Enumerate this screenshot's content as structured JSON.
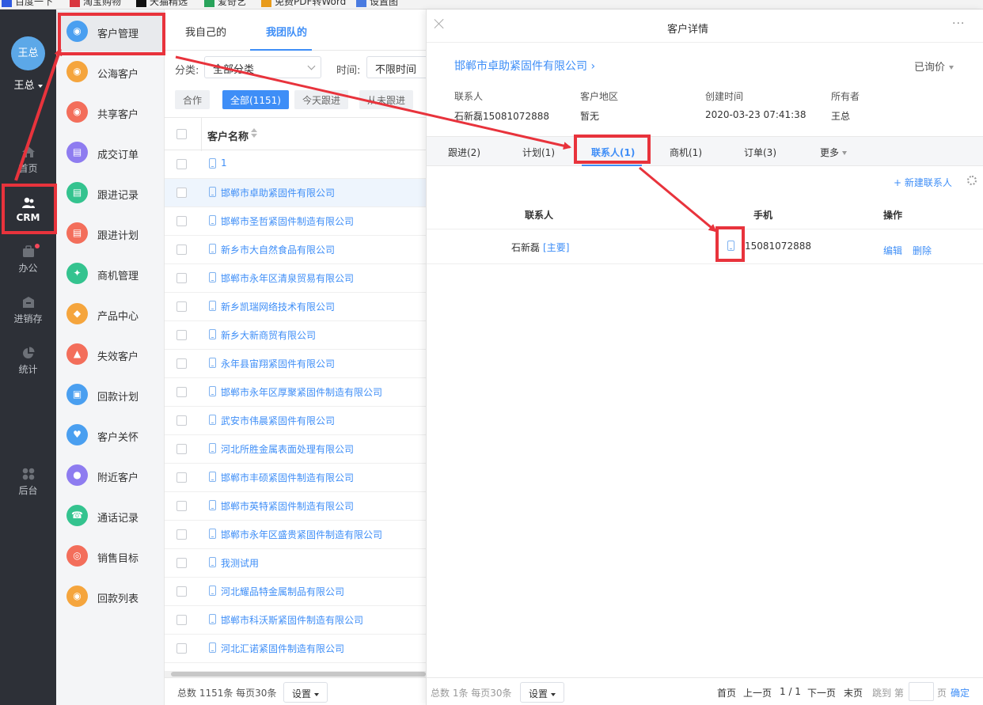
{
  "bookmarks": [
    {
      "label": "百度一下",
      "color": "#2f5ae0"
    },
    {
      "label": "淘宝购物",
      "color": "#d9363e"
    },
    {
      "label": "天猫精选",
      "color": "#111111"
    },
    {
      "label": "爱奇艺",
      "color": "#29a35b"
    },
    {
      "label": "免费PDF转Word",
      "color": "#e89b1c"
    },
    {
      "label": "设置图",
      "color": "#4a7be0"
    }
  ],
  "sidebar": {
    "avatar_text": "王总",
    "user_name": "王总",
    "items": [
      {
        "label": "首页",
        "icon": "home-icon"
      },
      {
        "label": "CRM",
        "icon": "crm-icon"
      },
      {
        "label": "办公",
        "icon": "office-icon"
      },
      {
        "label": "进销存",
        "icon": "inventory-icon"
      },
      {
        "label": "统计",
        "icon": "chart-pie-icon"
      },
      {
        "label": "后台",
        "icon": "grid-icon"
      }
    ]
  },
  "menu": {
    "items": [
      {
        "label": "客户管理",
        "color": "#4a9ff0",
        "icon": "customer-icon"
      },
      {
        "label": "公海客户",
        "color": "#f5a53d",
        "icon": "public-customer-icon"
      },
      {
        "label": "共享客户",
        "color": "#f36e5b",
        "icon": "share-customer-icon"
      },
      {
        "label": "成交订单",
        "color": "#8e7cf0",
        "icon": "order-icon"
      },
      {
        "label": "跟进记录",
        "color": "#34c38f",
        "icon": "record-icon"
      },
      {
        "label": "跟进计划",
        "color": "#f36e5b",
        "icon": "plan-icon"
      },
      {
        "label": "商机管理",
        "color": "#34c38f",
        "icon": "opportunity-icon"
      },
      {
        "label": "产品中心",
        "color": "#f5a53d",
        "icon": "product-icon"
      },
      {
        "label": "失效客户",
        "color": "#f36e5b",
        "icon": "invalid-customer-icon"
      },
      {
        "label": "回款计划",
        "color": "#4a9ff0",
        "icon": "payment-plan-icon"
      },
      {
        "label": "客户关怀",
        "color": "#4a9ff0",
        "icon": "care-icon"
      },
      {
        "label": "附近客户",
        "color": "#8e7cf0",
        "icon": "nearby-icon"
      },
      {
        "label": "通话记录",
        "color": "#34c38f",
        "icon": "call-icon"
      },
      {
        "label": "销售目标",
        "color": "#f36e5b",
        "icon": "target-icon"
      },
      {
        "label": "回款列表",
        "color": "#f5a53d",
        "icon": "payment-list-icon"
      }
    ]
  },
  "list": {
    "tabs": [
      "我自己的",
      "我团队的"
    ],
    "filter_category_label": "分类:",
    "filter_category_value": "全部分类",
    "filter_time_label": "时间:",
    "filter_time_value": "不限时间",
    "chips": [
      "合作",
      "全部(1151)",
      "今天跟进",
      "从未跟进"
    ],
    "column_header": "客户名称",
    "rows": [
      "1",
      "邯郸市卓助紧固件有限公司",
      "邯郸市圣哲紧固件制造有限公司",
      "新乡市大自然食品有限公司",
      "邯郸市永年区清泉贸易有限公司",
      "新乡凯瑞网络技术有限公司",
      "新乡大新商贸有限公司",
      "永年县宙翔紧固件有限公司",
      "邯郸市永年区厚聚紧固件制造有限公司",
      "武安市伟晨紧固件有限公司",
      "河北所胜金属表面处理有限公司",
      "邯郸市丰硕紧固件制造有限公司",
      "邯郸市英特紧固件制造有限公司",
      "邯郸市永年区盛贵紧固件制造有限公司",
      "我测试用",
      "河北耀品特金属制品有限公司",
      "邯郸市科沃斯紧固件制造有限公司",
      "河北汇诺紧固件制造有限公司"
    ],
    "footer_total": "总数 1151条 每页30条",
    "footer_settings": "设置"
  },
  "detail": {
    "title": "客户详情",
    "more": "···",
    "company": "邯郸市卓助紧固件有限公司",
    "status": "已询价",
    "info": [
      {
        "label": "联系人",
        "value": "石新磊15081072888"
      },
      {
        "label": "客户地区",
        "value": "暂无"
      },
      {
        "label": "创建时间",
        "value": "2020-03-23 07:41:38"
      },
      {
        "label": "所有者",
        "value": "王总"
      }
    ],
    "tabs": [
      "跟进(2)",
      "计划(1)",
      "联系人(1)",
      "商机(1)",
      "订单(3)",
      "更多"
    ],
    "new_contact": "+ 新建联系人",
    "contacts_headers": [
      "联系人",
      "手机",
      "操作"
    ],
    "contact": {
      "name": "石新磊",
      "tag": "[主要]",
      "phone": "15081072888",
      "edit": "编辑",
      "delete": "删除"
    },
    "footer_total": "总数 1条 每页30条",
    "footer_settings": "设置",
    "pagination": {
      "first": "首页",
      "prev": "上一页",
      "current": "1 / 1",
      "next": "下一页",
      "last": "末页",
      "goto": "跳到 第",
      "page": "页",
      "confirm": "确定"
    }
  },
  "annotation_color": "#e8333c"
}
